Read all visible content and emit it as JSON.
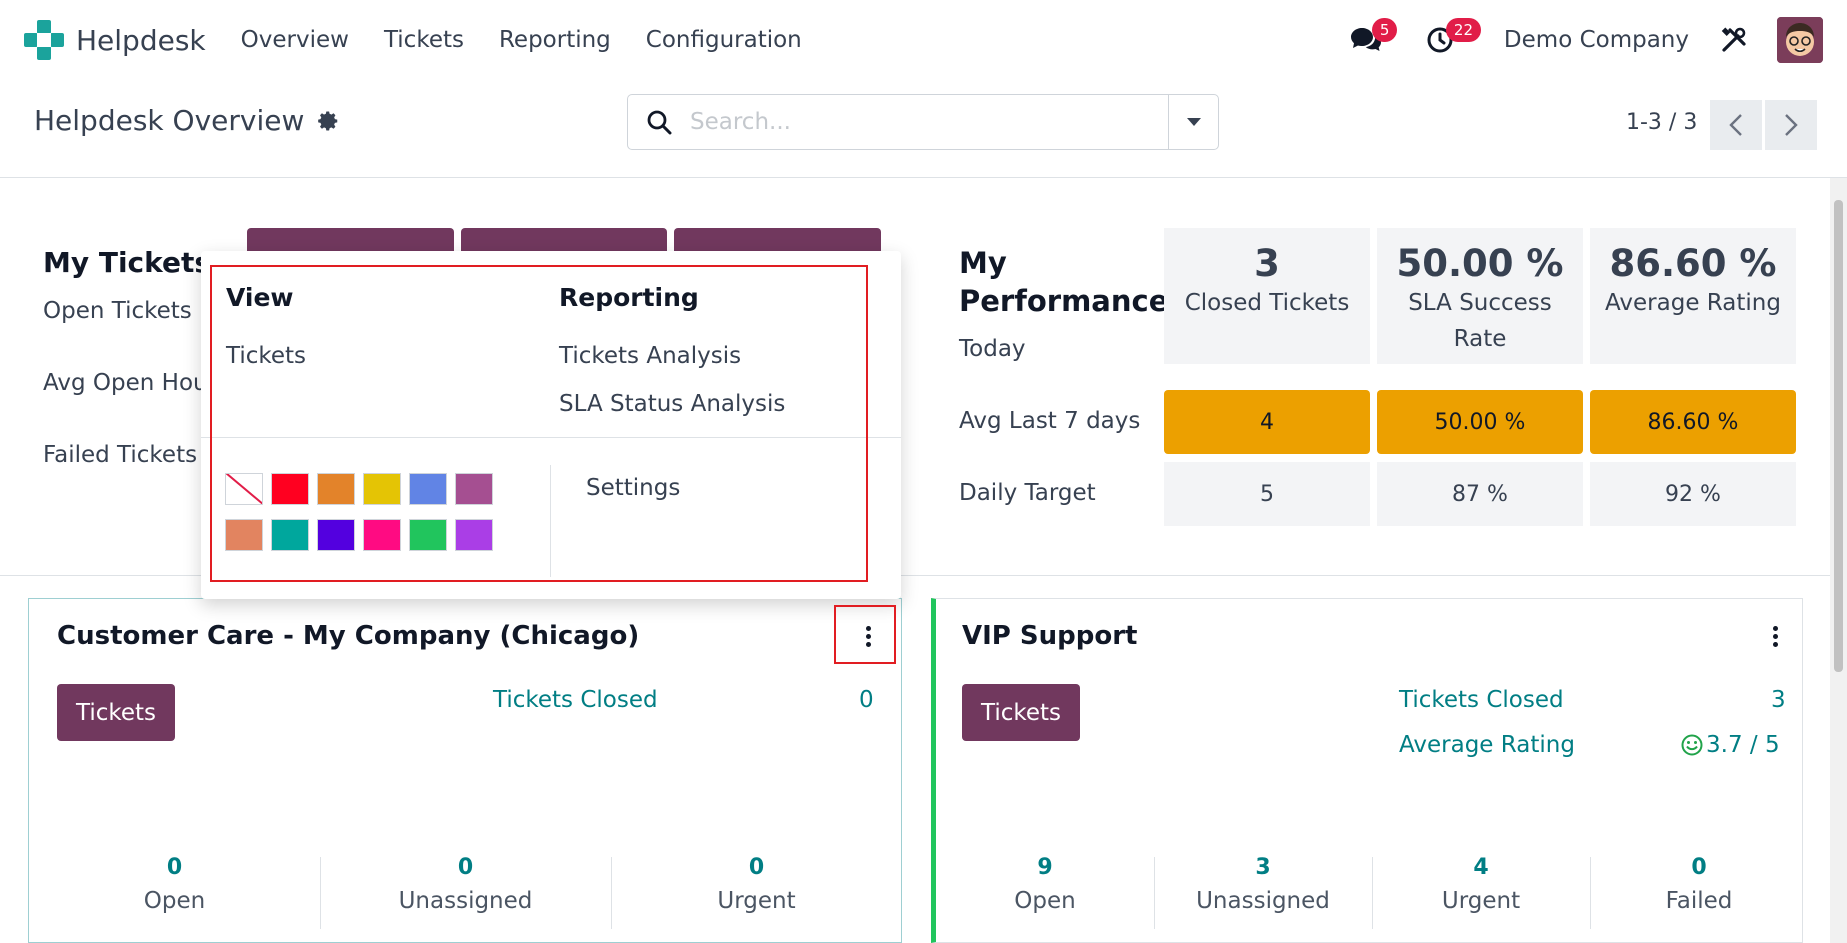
{
  "app": {
    "name": "Helpdesk"
  },
  "menu": [
    "Overview",
    "Tickets",
    "Reporting",
    "Configuration"
  ],
  "nav": {
    "messages_badge": "5",
    "activities_badge": "22",
    "company": "Demo Company"
  },
  "control": {
    "title": "Helpdesk Overview",
    "search_placeholder": "Search...",
    "pager": "1-3 / 3"
  },
  "my_tickets": {
    "title": "My Tickets",
    "rows": [
      "Open Tickets",
      "Avg Open Hou",
      "Failed Tickets"
    ]
  },
  "performance": {
    "title_line1": "My",
    "title_line2": "Performance",
    "today_label": "Today",
    "avg_label": "Avg Last 7 days",
    "target_label": "Daily Target",
    "columns": [
      {
        "big": "3",
        "sub": "Closed Tickets",
        "avg": "4",
        "target": "5"
      },
      {
        "big": "50.00 %",
        "sub1": "SLA Success",
        "sub2": "Rate",
        "avg": "50.00 %",
        "target": "87 %"
      },
      {
        "big": "86.60 %",
        "sub": "Average Rating",
        "avg": "86.60 %",
        "target": "92 %"
      }
    ],
    "avg_color": "#eca000"
  },
  "dropdown": {
    "view_head": "View",
    "view_items": [
      "Tickets"
    ],
    "reporting_head": "Reporting",
    "reporting_items": [
      "Tickets Analysis",
      "SLA Status Analysis"
    ],
    "settings": "Settings",
    "colors": [
      "#ff0020",
      "#e3832a",
      "#e4c405",
      "#6184e5",
      "#a54f91",
      "#e28460",
      "#00a79d",
      "#5300df",
      "#ff0b82",
      "#21c55d",
      "#aa3ee6"
    ]
  },
  "cards": [
    {
      "title": "Customer Care - My Company (Chicago)",
      "button": "Tickets",
      "closed_label": "Tickets Closed",
      "closed_value": "0",
      "stats": [
        {
          "num": "0",
          "label": "Open"
        },
        {
          "num": "0",
          "label": "Unassigned"
        },
        {
          "num": "0",
          "label": "Urgent"
        }
      ]
    },
    {
      "title": "VIP Support",
      "button": "Tickets",
      "closed_label": "Tickets Closed",
      "closed_value": "3",
      "rating_label": "Average Rating",
      "rating_value": "3.7 / 5",
      "accent": "#21c55d",
      "stats": [
        {
          "num": "9",
          "label": "Open"
        },
        {
          "num": "3",
          "label": "Unassigned"
        },
        {
          "num": "4",
          "label": "Urgent"
        },
        {
          "num": "0",
          "label": "Failed"
        }
      ]
    }
  ],
  "brand_color": "#71385e",
  "link_color": "#017e84"
}
